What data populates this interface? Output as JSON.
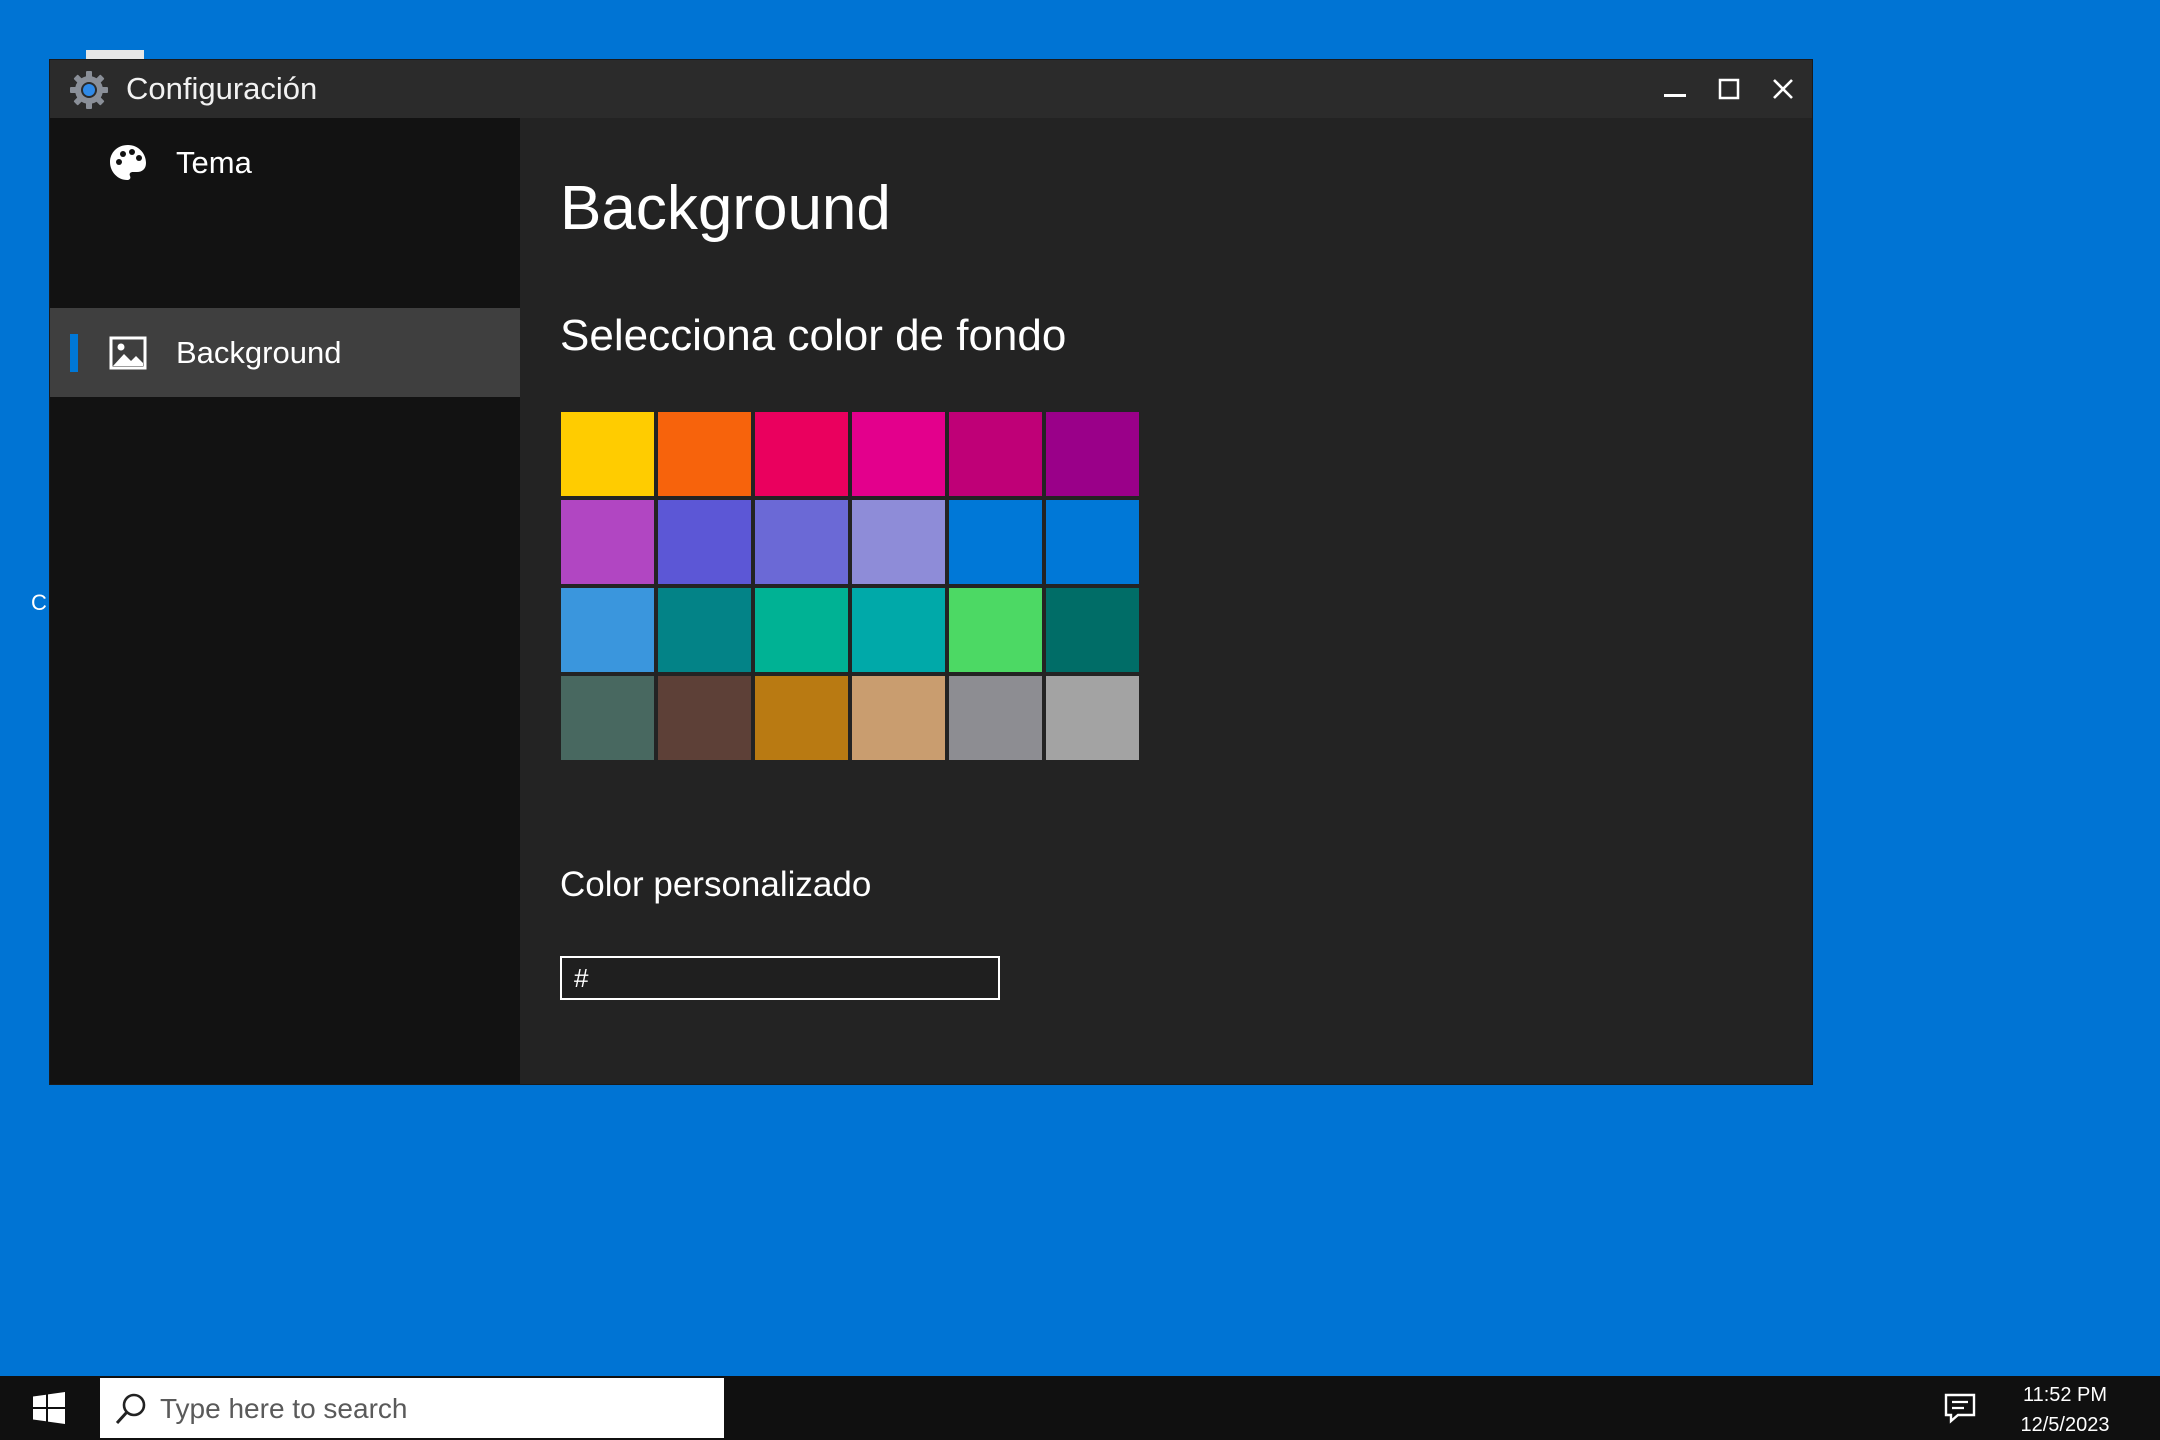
{
  "desktop": {
    "label_fragment": "C"
  },
  "window": {
    "title": "Configuración",
    "controls": [
      "minimize",
      "maximize",
      "close"
    ]
  },
  "sidebar": {
    "items": [
      {
        "label": "Tema",
        "icon": "palette-icon",
        "active": false
      },
      {
        "label": "Background",
        "icon": "image-icon",
        "active": true
      }
    ]
  },
  "content": {
    "page_title": "Background",
    "section_title": "Selecciona color de fondo",
    "swatch_colors": [
      "#ffcc00",
      "#f7630c",
      "#ea005e",
      "#e3008c",
      "#bf0077",
      "#9a0089",
      "#b146c2",
      "#5c57d6",
      "#6b69d6",
      "#8e8cd8",
      "#0078d7",
      "#0078d7",
      "#3a96dd",
      "#038387",
      "#00b294",
      "#00a9a9",
      "#4cd964",
      "#006d67",
      "#486860",
      "#5d4037",
      "#b97a12",
      "#c99d6f",
      "#8d8d92",
      "#a3a3a3"
    ],
    "custom_label": "Color personalizado",
    "custom_prefix": "#",
    "custom_value": ""
  },
  "taskbar": {
    "search_placeholder": "Type here to search",
    "time": "11:52 PM",
    "date": "12/5/2023"
  },
  "colors": {
    "desktop": "#0074d4",
    "accent": "#0078d7",
    "sidebar": "#121212",
    "content": "#232323",
    "titlebar": "#2b2b2b"
  }
}
